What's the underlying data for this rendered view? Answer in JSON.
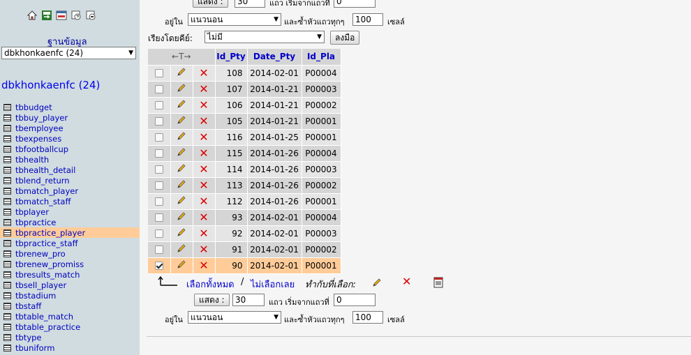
{
  "sidebar": {
    "db_caption": "ฐานข้อมูล",
    "db_select_value": "dbkhonkaenfc (24)",
    "db_heading": "dbkhonkaenfc (24)",
    "tables": [
      {
        "name": "tbbudget",
        "active": false
      },
      {
        "name": "tbbuy_player",
        "active": false
      },
      {
        "name": "tbemployee",
        "active": false
      },
      {
        "name": "tbexpenses",
        "active": false
      },
      {
        "name": "tbfootballcup",
        "active": false
      },
      {
        "name": "tbhealth",
        "active": false
      },
      {
        "name": "tbhealth_detail",
        "active": false
      },
      {
        "name": "tblend_return",
        "active": false
      },
      {
        "name": "tbmatch_player",
        "active": false
      },
      {
        "name": "tbmatch_staff",
        "active": false
      },
      {
        "name": "tbplayer",
        "active": false
      },
      {
        "name": "tbpractice",
        "active": false
      },
      {
        "name": "tbpractice_player",
        "active": true
      },
      {
        "name": "tbpractice_staff",
        "active": false
      },
      {
        "name": "tbrenew_pro",
        "active": false
      },
      {
        "name": "tbrenew_promiss",
        "active": false
      },
      {
        "name": "tbresults_match",
        "active": false
      },
      {
        "name": "tbsell_player",
        "active": false
      },
      {
        "name": "tbstadium",
        "active": false
      },
      {
        "name": "tbstaff",
        "active": false
      },
      {
        "name": "tbtable_match",
        "active": false
      },
      {
        "name": "tbtable_practice",
        "active": false
      },
      {
        "name": "tbtype",
        "active": false
      },
      {
        "name": "tbuniform",
        "active": false
      }
    ]
  },
  "top_nav": {
    "show_button": "แสดง :",
    "rows_value": "30",
    "start_label": "แถว เริ่มจากแถวที่",
    "start_value": "0",
    "in_label": "อยู่ใน",
    "mode_value": "แนวนอน",
    "repeat_label": "และซ้ำหัวแถวทุกๆ",
    "repeat_value": "100",
    "cells_label": "เซลล์"
  },
  "sort": {
    "label": "เรียงโดยคีย์:",
    "value": "ไม่มี",
    "go_button": "ลงมือ"
  },
  "results": {
    "arrows": "←T→",
    "columns": [
      "Id_Pty",
      "Date_Pty",
      "Id_Pla"
    ],
    "rows": [
      {
        "id": "108",
        "date": "2014-02-01",
        "pla": "P00004",
        "checked": false
      },
      {
        "id": "107",
        "date": "2014-01-21",
        "pla": "P00003",
        "checked": false
      },
      {
        "id": "106",
        "date": "2014-01-21",
        "pla": "P00002",
        "checked": false
      },
      {
        "id": "105",
        "date": "2014-01-21",
        "pla": "P00001",
        "checked": false
      },
      {
        "id": "116",
        "date": "2014-01-25",
        "pla": "P00001",
        "checked": false
      },
      {
        "id": "115",
        "date": "2014-01-26",
        "pla": "P00004",
        "checked": false
      },
      {
        "id": "114",
        "date": "2014-01-26",
        "pla": "P00003",
        "checked": false
      },
      {
        "id": "113",
        "date": "2014-01-26",
        "pla": "P00002",
        "checked": false
      },
      {
        "id": "112",
        "date": "2014-01-26",
        "pla": "P00001",
        "checked": false
      },
      {
        "id": "93",
        "date": "2014-02-01",
        "pla": "P00004",
        "checked": false
      },
      {
        "id": "92",
        "date": "2014-02-01",
        "pla": "P00003",
        "checked": false
      },
      {
        "id": "91",
        "date": "2014-02-01",
        "pla": "P00002",
        "checked": false
      },
      {
        "id": "90",
        "date": "2014-02-01",
        "pla": "P00001",
        "checked": true
      }
    ]
  },
  "selection": {
    "check_all": "เลือกทั้งหมด",
    "separator": " / ",
    "uncheck_all": "ไม่เลือกเลย",
    "with_selected": "ทำกับที่เลือก:"
  },
  "bottom_nav": {
    "show_button": "แสดง :",
    "rows_value": "30",
    "start_label": "แถว เริ่มจากแถวที่",
    "start_value": "0",
    "in_label": "อยู่ใน",
    "mode_value": "แนวนอน",
    "repeat_label": "และซ้ำหัวแถวทุกๆ",
    "repeat_value": "100",
    "cells_label": "เซลล์"
  },
  "colors": {
    "sidebar_bg": "#d0dce0",
    "active_row": "#ffcc99",
    "header_text": "#0000cc",
    "delete_red": "#dd0000"
  }
}
